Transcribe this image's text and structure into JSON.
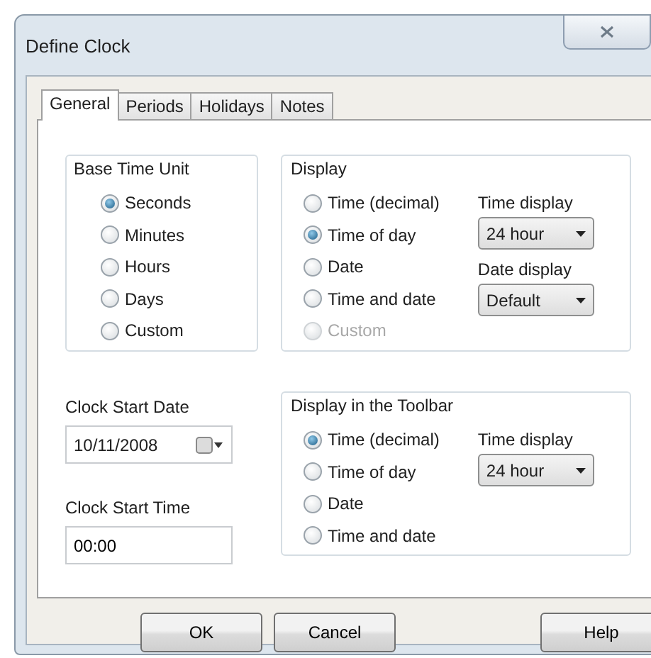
{
  "window": {
    "title": "Define Clock"
  },
  "tabs": [
    {
      "label": "General",
      "selected": true
    },
    {
      "label": "Periods",
      "selected": false
    },
    {
      "label": "Holidays",
      "selected": false
    },
    {
      "label": "Notes",
      "selected": false
    }
  ],
  "base_time_unit": {
    "title": "Base Time Unit",
    "options": [
      {
        "label": "Seconds",
        "selected": true
      },
      {
        "label": "Minutes",
        "selected": false
      },
      {
        "label": "Hours",
        "selected": false
      },
      {
        "label": "Days",
        "selected": false
      },
      {
        "label": "Custom",
        "selected": false
      }
    ]
  },
  "display": {
    "title": "Display",
    "options": [
      {
        "label": "Time (decimal)",
        "selected": false,
        "disabled": false
      },
      {
        "label": "Time of day",
        "selected": true,
        "disabled": false
      },
      {
        "label": "Date",
        "selected": false,
        "disabled": false
      },
      {
        "label": "Time and date",
        "selected": false,
        "disabled": false
      },
      {
        "label": "Custom",
        "selected": false,
        "disabled": true
      }
    ],
    "time_display": {
      "label": "Time display",
      "value": "24 hour"
    },
    "date_display": {
      "label": "Date display",
      "value": "Default"
    }
  },
  "clock_start_date": {
    "label": "Clock Start Date",
    "value": "10/11/2008"
  },
  "clock_start_time": {
    "label": "Clock Start Time",
    "value": "00:00"
  },
  "toolbar_display": {
    "title": "Display in the Toolbar",
    "options": [
      {
        "label": "Time (decimal)",
        "selected": true
      },
      {
        "label": "Time of day",
        "selected": false
      },
      {
        "label": "Date",
        "selected": false
      },
      {
        "label": "Time and date",
        "selected": false
      }
    ],
    "time_display": {
      "label": "Time display",
      "value": "24 hour"
    }
  },
  "buttons": [
    {
      "label": "OK"
    },
    {
      "label": "Cancel"
    }
  ],
  "help_button": {
    "label": "Help"
  }
}
